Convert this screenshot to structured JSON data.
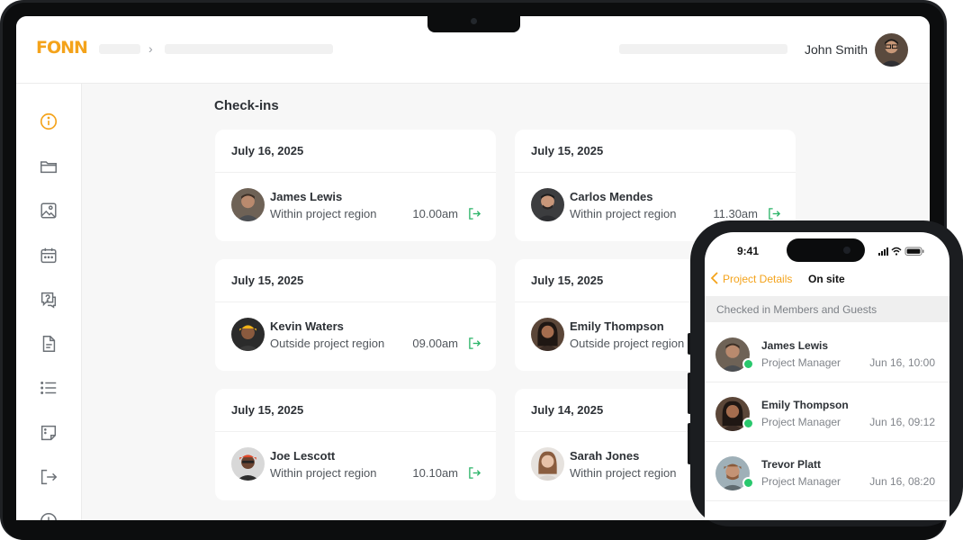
{
  "app": {
    "logo": "FONN"
  },
  "header": {
    "user_name": "John Smith"
  },
  "sidebar": {
    "items": [
      {
        "icon": "info-icon",
        "active": true
      },
      {
        "icon": "folder-icon",
        "active": false
      },
      {
        "icon": "image-icon",
        "active": false
      },
      {
        "icon": "calendar-icon",
        "active": false
      },
      {
        "icon": "help-chat-icon",
        "active": false
      },
      {
        "icon": "document-icon",
        "active": false
      },
      {
        "icon": "list-icon",
        "active": false
      },
      {
        "icon": "sticky-note-icon",
        "active": false
      },
      {
        "icon": "check-in-icon",
        "active": false
      },
      {
        "icon": "clock-icon",
        "active": false
      }
    ]
  },
  "main": {
    "title": "Check-ins",
    "cards": [
      {
        "date": "July 16, 2025",
        "name": "James Lewis",
        "region": "Within project region",
        "time": "10.00am"
      },
      {
        "date": "July 15, 2025",
        "name": "Carlos Mendes",
        "region": "Within project region",
        "time": "11.30am"
      },
      {
        "date": "July 15, 2025",
        "name": "Kevin Waters",
        "region": "Outside project region",
        "time": "09.00am"
      },
      {
        "date": "July 15, 2025",
        "name": "Emily Thompson",
        "region": "Outside project region",
        "time": ""
      },
      {
        "date": "July 15, 2025",
        "name": "Joe Lescott",
        "region": "Within project region",
        "time": "10.10am"
      },
      {
        "date": "July 14, 2025",
        "name": "Sarah Jones",
        "region": "Within project region",
        "time": ""
      }
    ]
  },
  "phone": {
    "status_time": "9:41",
    "back_label": "Project Details",
    "tab_label": "On site",
    "section_title": "Checked in Members and Guests",
    "members": [
      {
        "name": "James Lewis",
        "role": "Project Manager",
        "time": "Jun 16, 10:00"
      },
      {
        "name": "Emily Thompson",
        "role": "Project Manager",
        "time": "Jun 16, 09:12"
      },
      {
        "name": "Trevor Platt",
        "role": "Project Manager",
        "time": "Jun 16, 08:20"
      }
    ]
  },
  "colors": {
    "accent": "#f4a31b",
    "success": "#29c86d",
    "checkin_icon": "#2bb468"
  }
}
